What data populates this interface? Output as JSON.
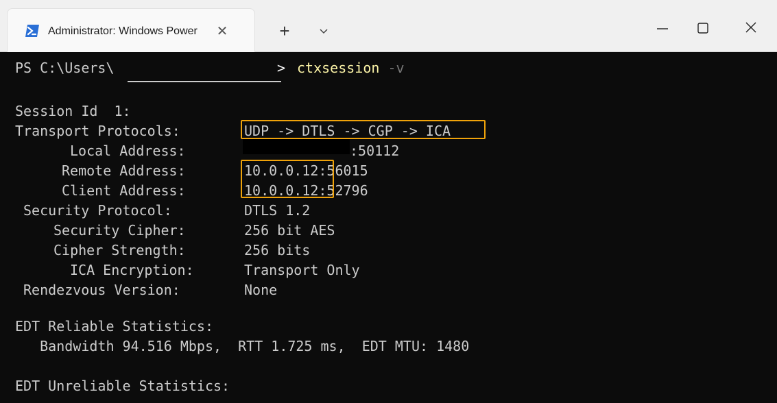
{
  "titlebar": {
    "tab_title": "Administrator: Windows PowerShell",
    "tab_icon": "powershell-icon",
    "close_tab_glyph": "✕",
    "new_tab_glyph": "+",
    "dropdown_icon": "chevron-down-icon",
    "minimize_icon": "minimize-icon",
    "maximize_icon": "maximize-icon",
    "close_icon": "close-icon"
  },
  "terminal": {
    "prompt_prefix": "PS C:\\Users\\",
    "prompt_suffix": ">",
    "command": "ctxsession",
    "param": "-v",
    "session_id_line": "Session Id  1:",
    "fields": {
      "transport_protocols": {
        "label": "Transport Protocols:",
        "value": "UDP -> DTLS -> CGP -> ICA"
      },
      "local_address": {
        "label": "Local Address:",
        "value": ":50112"
      },
      "remote_address": {
        "label": "Remote Address:",
        "value": "10.0.0.12:56015"
      },
      "client_address": {
        "label": "Client Address:",
        "value": "10.0.0.12:52796"
      },
      "security_protocol": {
        "label": "Security Protocol:",
        "value": "DTLS 1.2"
      },
      "security_cipher": {
        "label": "Security Cipher:",
        "value": "256 bit AES"
      },
      "cipher_strength": {
        "label": "Cipher Strength:",
        "value": "256 bits"
      },
      "ica_encryption": {
        "label": "ICA Encryption:",
        "value": "Transport Only"
      },
      "rendezvous_version": {
        "label": "Rendezvous Version:",
        "value": "None"
      }
    },
    "edt_reliable_heading": "EDT Reliable Statistics:",
    "edt_reliable_stats": "   Bandwidth 94.516 Mbps,  RTT 1.725 ms,  EDT MTU: 1480",
    "edt_unreliable_heading": "EDT Unreliable Statistics:"
  },
  "colors": {
    "terminal_bg": "#0c0c0c",
    "terminal_fg": "#cccccc",
    "command": "#f9f1a5",
    "parameter": "#767676",
    "highlight_box": "#f0a30a"
  }
}
